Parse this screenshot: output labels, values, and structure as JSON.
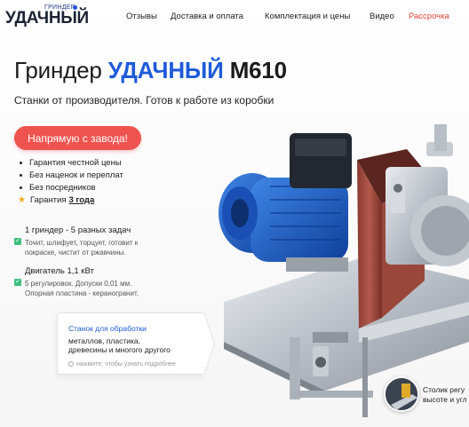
{
  "logo": {
    "small": "ГРИНДЕР",
    "main": "УДАЧНЫЙ"
  },
  "nav": {
    "items": [
      "Отзывы",
      "Доставка и оплата",
      "Комплектация и цены",
      "Видео",
      "Рассрочка"
    ],
    "accent_color": "#e4453b"
  },
  "hero": {
    "title_prefix": "Гриндер",
    "title_brand": "УДАЧНЫЙ",
    "title_model": "М610",
    "subtitle": "Станки от производителя. Готов к работе из коробки",
    "brand_color": "#1e5bd8"
  },
  "cta": {
    "label": "Напрямую с завода!",
    "color": "#ef5350"
  },
  "bullets": [
    "Гарантия честной цены",
    "Без наценок и переплат",
    "Без посредников"
  ],
  "guarantee": {
    "label": "Гарантия",
    "value": "3 года"
  },
  "features": [
    {
      "title": "1 гриндер - 5 разных задач",
      "desc_lines": [
        "Точит, шлифует, торцует, готовит к",
        "покраске, чистит от ржавчины."
      ]
    },
    {
      "title": "Двигатель 1,1 кВт",
      "desc_lines": [
        "5 регулировок. Допуски 0,01 мм.",
        "Опорная пластина - кераногранит."
      ]
    }
  ],
  "card": {
    "title": "Станок для обработки",
    "desc_lines": [
      "металлов, пластика,",
      "древесины и многого другого"
    ],
    "hint": "нажмите, чтобы узнать подробнее"
  },
  "bubble": {
    "text_lines": [
      "Столик регу",
      "высоте и угл"
    ]
  },
  "icons": {
    "check": "check-icon",
    "star": "star-icon",
    "hint": "pointer-icon"
  }
}
